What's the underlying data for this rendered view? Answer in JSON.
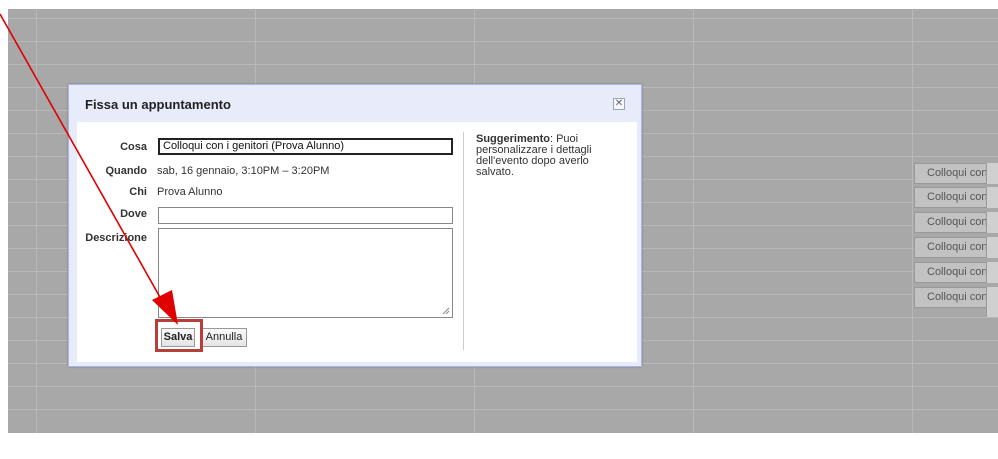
{
  "dialog": {
    "title": "Fissa un appuntamento",
    "close_glyph": "✕",
    "fields": {
      "what_label": "Cosa",
      "what_value": "Colloqui con i genitori (Prova Alunno)",
      "when_label": "Quando",
      "when_value": "sab, 16 gennaio, 3:10PM – 3:20PM",
      "who_label": "Chi",
      "who_value": "Prova Alunno",
      "where_label": "Dove",
      "where_value": "",
      "description_label": "Descrizione",
      "description_value": ""
    },
    "buttons": {
      "save_label": "Salva",
      "cancel_label": "Annulla"
    },
    "tip": {
      "bold": "Suggerimento",
      "text": ": Puoi personalizzare i dettagli dell'evento dopo averlo salvato."
    }
  },
  "calendar": {
    "events": [
      {
        "label": "Colloqui con"
      },
      {
        "label": "Colloqui con"
      },
      {
        "label": "Colloqui con"
      },
      {
        "label": "Colloqui con"
      },
      {
        "label": "Colloqui con"
      },
      {
        "label": "Colloqui con"
      }
    ]
  },
  "annotation": {
    "arrow_color": "#e00000",
    "highlight_color": "#b5403a"
  }
}
